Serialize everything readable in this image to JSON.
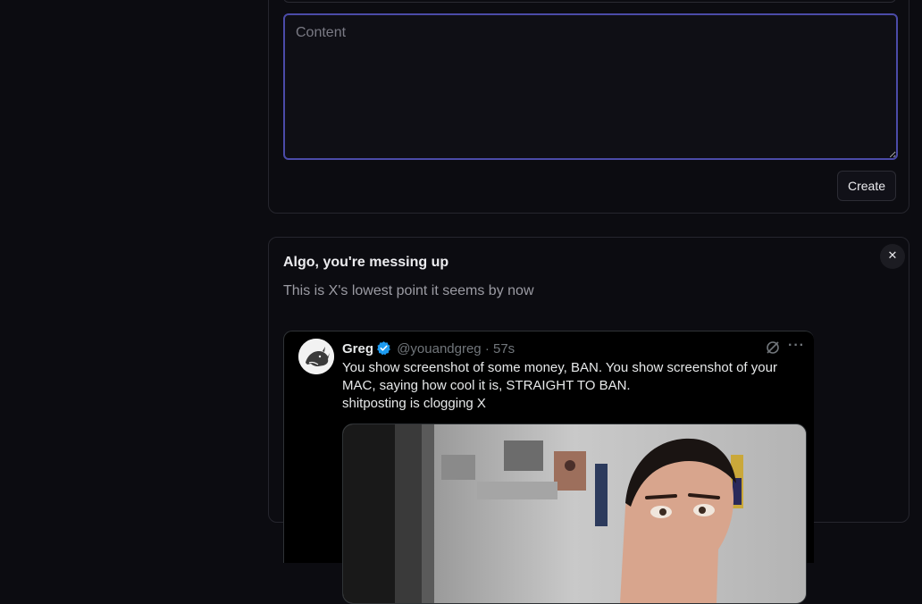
{
  "form": {
    "content_placeholder": "Content",
    "create_label": "Create"
  },
  "post": {
    "title": "Algo, you're messing up",
    "body": "This is X's lowest point it seems by now",
    "close_label": "✕",
    "tweet": {
      "name": "Greg",
      "handle": "@youandgreg",
      "separator": "·",
      "time": "57s",
      "text_lines": [
        "You show screenshot of some money, BAN. You show screenshot of your",
        "MAC, saying how cool it is, STRAIGHT TO BAN.",
        "shitposting is clogging X"
      ],
      "more_label": "···",
      "verified_color": "#1d9bf0",
      "icons": [
        "verified-badge-icon",
        "grok-icon",
        "more-icon"
      ]
    }
  }
}
